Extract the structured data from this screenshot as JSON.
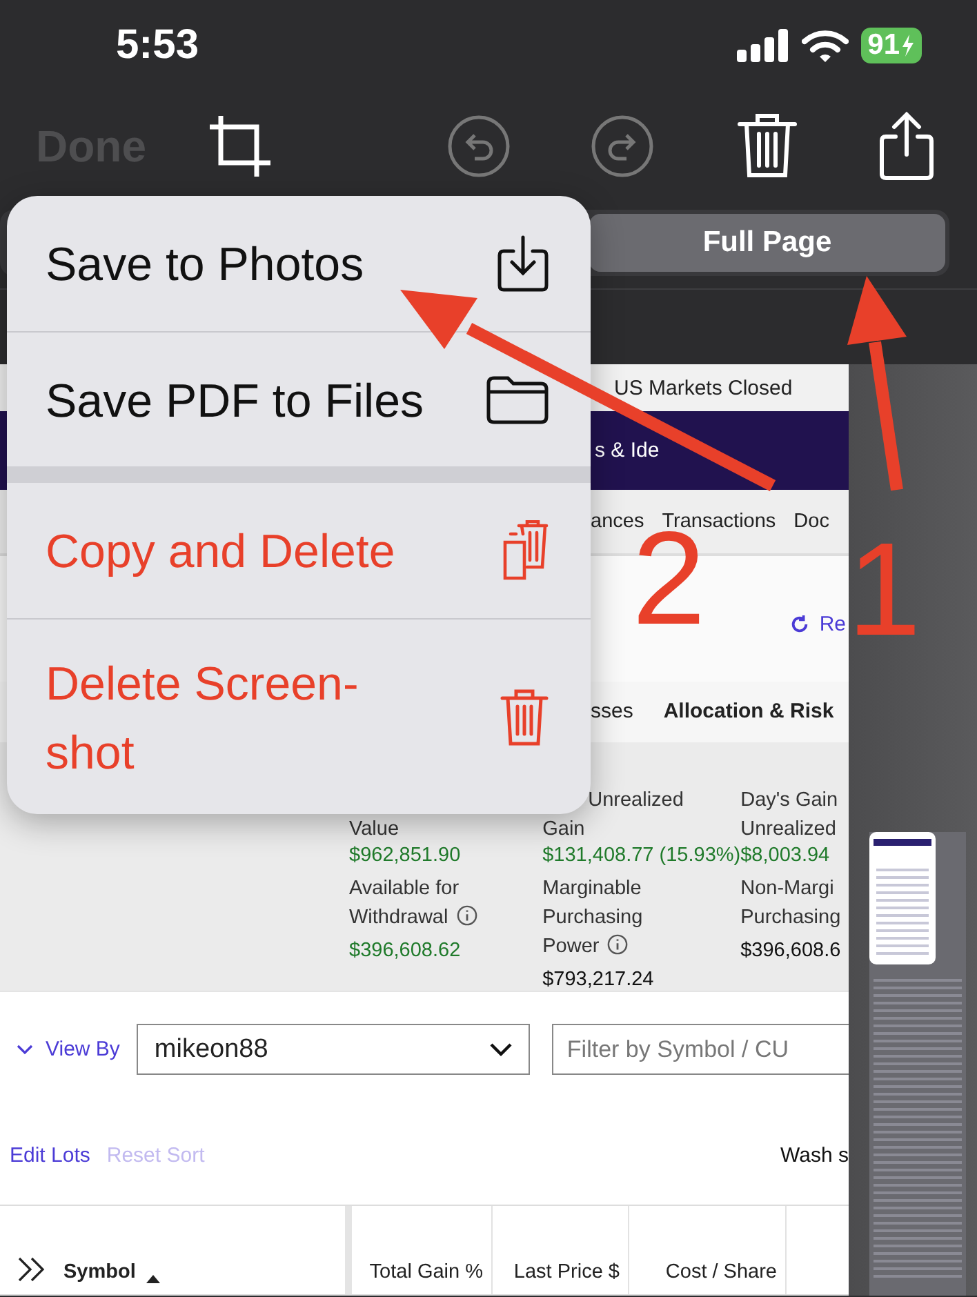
{
  "status_bar": {
    "time": "5:53",
    "battery": "91"
  },
  "toolbar": {
    "done": {
      "label": "Done",
      "disabled": true
    },
    "undo": {
      "disabled": true
    },
    "redo": {
      "disabled": true
    }
  },
  "tabs": [
    {
      "label": "Full Page",
      "selected": true
    }
  ],
  "menu": {
    "groups": [
      [
        {
          "label": "Save to Photos",
          "kind": "normal"
        },
        {
          "label": "Save PDF to Files",
          "kind": "normal"
        }
      ],
      [
        {
          "label": "Copy and Delete",
          "kind": "destructive"
        },
        {
          "label": "Delete Screen-shot",
          "kind": "destructive"
        }
      ]
    ]
  },
  "preview": {
    "market_status": "US Markets Closed",
    "nav_fragment": "s & Ide",
    "tabs": [
      "ances",
      "Transactions",
      "Doc"
    ],
    "refresh": "Re",
    "subtabs": [
      "sses",
      "Allocation & Risk"
    ],
    "metrics": [
      {
        "label": "Value",
        "value": "$962,851.90",
        "positive": true
      },
      {
        "label": "Unrealized Gain",
        "value": "$131,408.77 (15.93%)",
        "positive": true
      },
      {
        "label": "Day's Gain Unrealized",
        "value": "$8,003.94",
        "positive": true
      },
      {
        "label": "Available for Withdrawal",
        "value": "$396,608.62",
        "positive": true,
        "info": true
      },
      {
        "label": "Marginable Purchasing Power",
        "value": "$793,217.24",
        "positive": false,
        "info": true
      },
      {
        "label": "Non-Margi Purchasing",
        "value": "$396,608.6",
        "positive": false
      }
    ],
    "view_by": {
      "label": "View By",
      "value": "mikeon88"
    },
    "filter": {
      "placeholder": "Filter by Symbol / CU"
    },
    "actions": [
      {
        "label": "Edit Lots",
        "disabled": false
      },
      {
        "label": "Reset Sort",
        "disabled": true
      }
    ],
    "wash": "Wash s",
    "table": {
      "columns": [
        {
          "label": "Symbol"
        },
        {
          "label": "Total Gain %"
        },
        {
          "label": "Last Price $"
        },
        {
          "label": "Cost / Share"
        }
      ]
    }
  },
  "annotations": [
    {
      "label": "2"
    },
    {
      "label": "1"
    }
  ]
}
